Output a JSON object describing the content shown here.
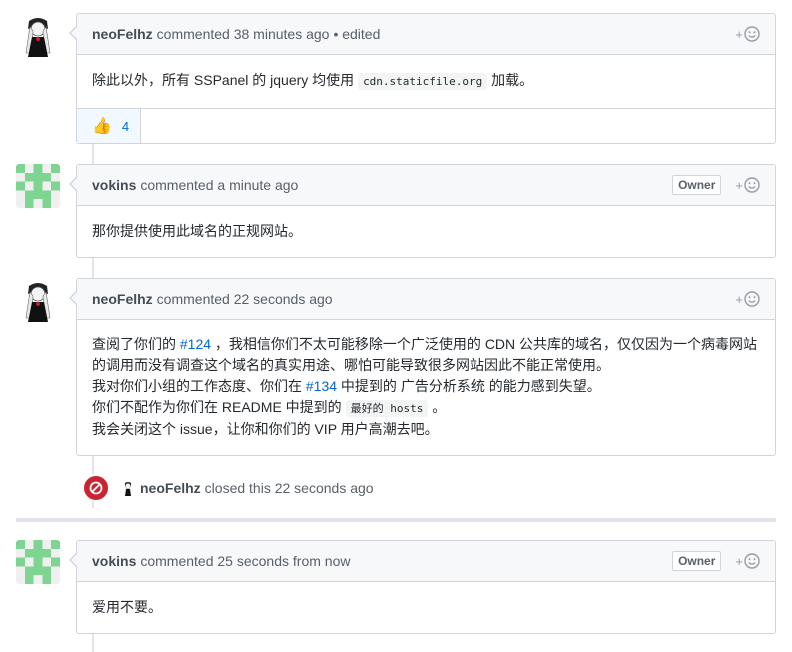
{
  "comments": [
    {
      "author": "neoFelhz",
      "meta": "commented 38 minutes ago",
      "edited": "• edited",
      "owner": "",
      "body": {
        "before": "除此以外，所有 SSPanel 的 jquery 均使用 ",
        "code": "cdn.staticfile.org",
        "after": " 加载。"
      },
      "reaction": {
        "emoji": "👍",
        "count": "4"
      }
    },
    {
      "author": "vokins",
      "meta": "commented a minute ago",
      "owner": "Owner",
      "body": {
        "text": "那你提供使用此域名的正规网站。"
      }
    },
    {
      "author": "neoFelhz",
      "meta": "commented 22 seconds ago",
      "owner": "",
      "body": {
        "l1_a": "查阅了你们的 ",
        "l1_link": "#124",
        "l1_b": " ，我相信你们不太可能移除一个广泛使用的 CDN 公共库的域名，仅仅因为一个病毒网站的调用而没有调查这个域名的真实用途、哪怕可能导致很多网站因此不能正常使用。",
        "l2_a": "我对你们小组的工作态度、你们在 ",
        "l2_link": "#134",
        "l2_b": " 中提到的 广告分析系统 的能力感到失望。",
        "l3_a": "你们不配作为你们在 README 中提到的 ",
        "l3_code": "最好的 hosts",
        "l3_b": " 。",
        "l4": "我会关闭这个 issue，让你和你们的 VIP 用户高潮去吧。"
      }
    },
    {
      "author": "vokins",
      "meta": "commented 25 seconds from now",
      "owner": "Owner",
      "body": {
        "text": "爱用不要。"
      }
    }
  ],
  "event": {
    "author": "neoFelhz",
    "text": "closed this 22 seconds ago",
    "icon": "circle-slash-icon"
  },
  "react_plus": "+",
  "colors": {
    "closed": "#cb2431",
    "link": "#0366d6",
    "identicon": "#7ed491"
  }
}
